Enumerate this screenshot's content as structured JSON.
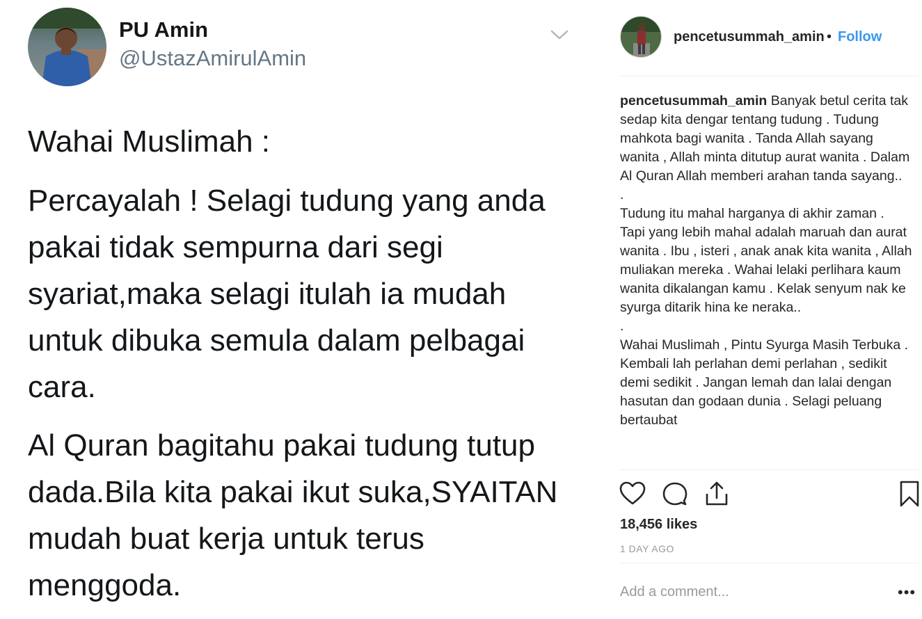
{
  "tweet": {
    "display_name": "PU Amin",
    "handle": "@UstazAmirulAmin",
    "caret_icon": "chevron-down-icon",
    "paragraphs": [
      "Wahai Muslimah :",
      "Percayalah ! Selagi tudung yang anda pakai tidak sempurna dari segi syariat,maka selagi itulah ia mudah untuk dibuka semula dalam pelbagai cara.",
      "Al Quran bagitahu pakai tudung tutup dada.Bila kita pakai ikut suka,SYAITAN mudah buat kerja untuk terus menggoda."
    ]
  },
  "instagram": {
    "username": "pencetusummah_amin",
    "separator": "•",
    "follow_label": "Follow",
    "caption_username": "pencetusummah_amin",
    "caption_lines": [
      "Banyak betul cerita tak sedap kita dengar tentang tudung . Tudung mahkota bagi wanita . Tanda Allah sayang wanita , Allah minta ditutup aurat wanita . Dalam Al Quran Allah memberi arahan tanda sayang..",
      ".",
      "Tudung itu mahal harganya di akhir zaman . Tapi yang lebih mahal adalah maruah dan aurat wanita . Ibu , isteri , anak anak kita wanita , Allah muliakan mereka . Wahai lelaki perlihara kaum wanita dikalangan kamu . Kelak senyum nak ke syurga ditarik hina ke neraka..",
      ".",
      "Wahai Muslimah , Pintu Syurga Masih Terbuka . Kembali lah perlahan demi perlahan , sedikit demi sedikit . Jangan lemah dan lalai dengan hasutan dan godaan dunia . Selagi peluang bertaubat"
    ],
    "actions": [
      "heart-icon",
      "comment-icon",
      "share-icon",
      "bookmark-icon"
    ],
    "likes": "18,456 likes",
    "timestamp": "1 DAY AGO",
    "comment_placeholder": "Add a comment...",
    "more_label": "•••",
    "colors": {
      "link": "#3897f0",
      "text": "#262626",
      "muted": "#999999",
      "tweet_handle": "#657786"
    }
  }
}
